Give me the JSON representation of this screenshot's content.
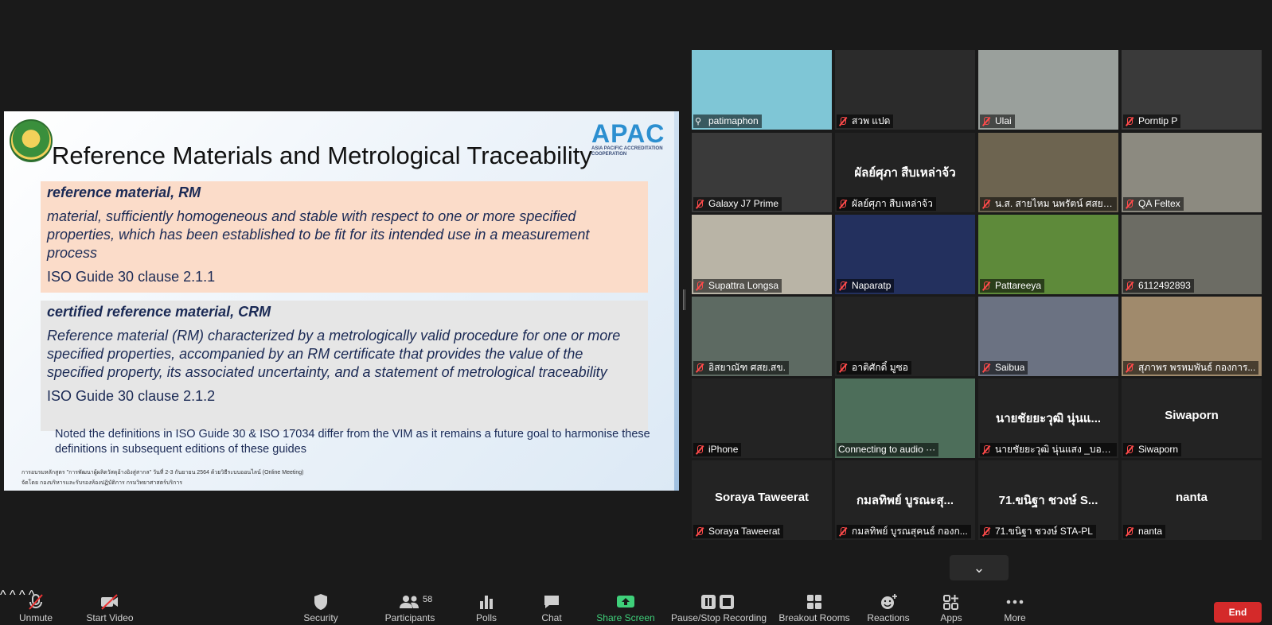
{
  "slide": {
    "title": "Reference Materials and Metrological Traceability",
    "logo_text": "APAC",
    "logo_subtitle": "ASIA PACIFIC ACCREDITATION COOPERATION",
    "rm": {
      "term": "reference material, RM",
      "definition": "material, sufficiently homogeneous and stable with respect to one or more specified properties, which has been established to be fit for its intended use in a measurement process",
      "clause": "ISO Guide 30 clause 2.1.1"
    },
    "crm": {
      "term": "certified reference material, CRM",
      "definition": "Reference material (RM) characterized by a metrologically valid procedure for one or more specified properties, accompanied by an RM certificate that provides the value of the specified property, its associated uncertainty, and a statement of metrological traceability",
      "clause": "ISO Guide 30 clause 2.1.2"
    },
    "note": "Noted the definitions in ISO Guide 30 & ISO 17034 differ from the VIM as it remains a future goal to harmonise these definitions in subsequent editions of these guides",
    "footer_line1": "การอบรมหลักสูตร \"การพัฒนาผู้ผลิตวัสดุอ้างอิงสู่สากล\" วันที่ 2-3 กันยายน 2564 ด้วยวิธีระบบออนไลน์ (Online Meeting)",
    "footer_line2": "จัดโดย กองบริหารและรับรองห้องปฏิบัติการ กรมวิทยาศาสตร์บริการ"
  },
  "participants": [
    {
      "label": "patimaphon",
      "big_name": "",
      "muted": false,
      "pinned": true,
      "active": true,
      "bg": "#7fc6d6"
    },
    {
      "label": "สวพ แปด",
      "big_name": "",
      "muted": true,
      "pinned": false,
      "active": false,
      "bg": "#2b2b2b"
    },
    {
      "label": "Ulai",
      "big_name": "",
      "muted": true,
      "pinned": false,
      "active": false,
      "bg": "#9aa09c"
    },
    {
      "label": "Porntip P",
      "big_name": "",
      "muted": true,
      "pinned": false,
      "active": false,
      "bg": "#3a3a3a"
    },
    {
      "label": "Galaxy J7 Prime",
      "big_name": "",
      "muted": true,
      "pinned": false,
      "active": false,
      "bg": "#3a3a3a"
    },
    {
      "label": "ผัลย์ศุภา สืบเหล่าจ้ว",
      "big_name": "ผัลย์ศุภา สืบเหล่าจ้ว",
      "muted": true,
      "pinned": false,
      "active": false,
      "bg": "#232323"
    },
    {
      "label": "น.ส. สายไหม นพรัตน์ ศสย.สข.",
      "big_name": "",
      "muted": true,
      "pinned": false,
      "active": false,
      "bg": "#6d6450"
    },
    {
      "label": "QA Feltex",
      "big_name": "",
      "muted": true,
      "pinned": false,
      "active": false,
      "bg": "#8c8a80"
    },
    {
      "label": "Supattra   Longsa",
      "big_name": "",
      "muted": true,
      "pinned": false,
      "active": false,
      "bg": "#b9b4a6"
    },
    {
      "label": "Naparatp",
      "big_name": "",
      "muted": true,
      "pinned": false,
      "active": false,
      "bg": "#23305e"
    },
    {
      "label": "Pattareeya",
      "big_name": "",
      "muted": true,
      "pinned": false,
      "active": false,
      "bg": "#5e8a3a"
    },
    {
      "label": "6112492893",
      "big_name": "",
      "muted": true,
      "pinned": false,
      "active": false,
      "bg": "#6c6c64"
    },
    {
      "label": "อิสยาณัฑ ศสย.สข.",
      "big_name": "",
      "muted": true,
      "pinned": false,
      "active": false,
      "bg": "#5d6a62"
    },
    {
      "label": "อาติศักดิ์ มูซอ",
      "big_name": "",
      "muted": true,
      "pinned": false,
      "active": false,
      "bg": "#232323"
    },
    {
      "label": "Saibua",
      "big_name": "",
      "muted": true,
      "pinned": false,
      "active": false,
      "bg": "#6b7282"
    },
    {
      "label": "สุภาพร พรหมพันธ์ กองการ...",
      "big_name": "",
      "muted": true,
      "pinned": false,
      "active": false,
      "bg": "#a08a6c"
    },
    {
      "label": "iPhone",
      "big_name": "",
      "muted": true,
      "pinned": false,
      "active": false,
      "bg": "#232323"
    },
    {
      "label": "Connecting to audio ···",
      "big_name": "",
      "muted": false,
      "pinned": false,
      "active": false,
      "bg": "#4d6e5a"
    },
    {
      "label": "นายชัยยะวุฒิ นุ่นแสง _บอย_S...",
      "big_name": "นายชัยยะวุฒิ นุ่นแ...",
      "muted": true,
      "pinned": false,
      "active": false,
      "bg": "#232323"
    },
    {
      "label": "Siwaporn",
      "big_name": "Siwaporn",
      "muted": true,
      "pinned": false,
      "active": false,
      "bg": "#232323"
    },
    {
      "label": "Soraya Taweerat",
      "big_name": "Soraya Taweerat",
      "muted": true,
      "pinned": false,
      "active": false,
      "bg": "#232323"
    },
    {
      "label": "กมลทิพย์ บูรณสุคนธ์ กองก...",
      "big_name": "กมลทิพย์ บูรณะสุ...",
      "muted": true,
      "pinned": false,
      "active": false,
      "bg": "#232323"
    },
    {
      "label": "71.ขนิฐา  ชวงษ์ STA-PL",
      "big_name": "71.ขนิฐา  ชวงษ์ S...",
      "muted": true,
      "pinned": false,
      "active": false,
      "bg": "#232323"
    },
    {
      "label": "nanta",
      "big_name": "nanta",
      "muted": true,
      "pinned": false,
      "active": false,
      "bg": "#232323"
    }
  ],
  "toolbar": {
    "unmute": "Unmute",
    "start_video": "Start Video",
    "security": "Security",
    "participants": "Participants",
    "participant_count": "58",
    "polls": "Polls",
    "chat": "Chat",
    "share_screen": "Share Screen",
    "pause_recording": "Pause/Stop Recording",
    "breakout_rooms": "Breakout Rooms",
    "reactions": "Reactions",
    "apps": "Apps",
    "more": "More",
    "end": "End"
  },
  "colors": {
    "active_speaker": "#c6d93a",
    "share_green": "#3fd07a",
    "end_red": "#d42a2a"
  }
}
